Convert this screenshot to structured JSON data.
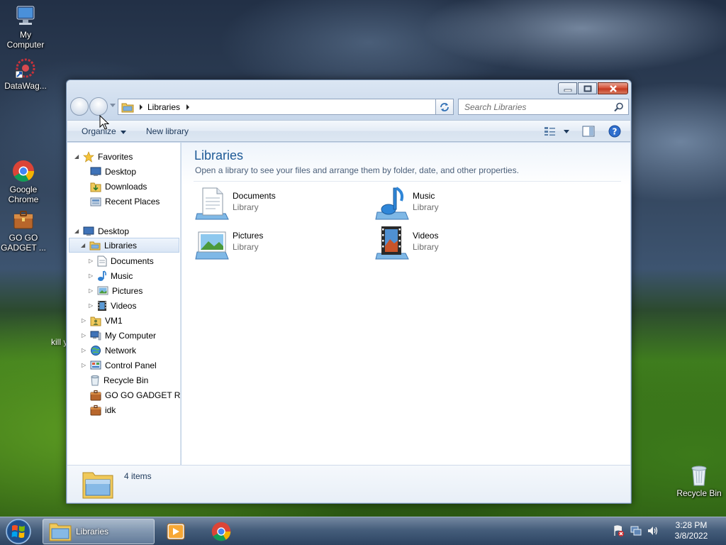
{
  "desktop": {
    "icons": [
      {
        "label": "My\nComputer"
      },
      {
        "label": "DataWag..."
      },
      {
        "label": "Google\nChrome"
      },
      {
        "label": "GO GO\nGADGET ..."
      },
      {
        "label": "Recycle Bin"
      }
    ],
    "stray_text": "kill y"
  },
  "window": {
    "address": {
      "crumb": "Libraries"
    },
    "search": {
      "placeholder": "Search Libraries"
    },
    "command_bar": {
      "organize": "Organize",
      "new_library": "New library"
    },
    "nav_tree": [
      {
        "label": "Favorites",
        "icon": "star-icon"
      },
      {
        "label": "Desktop",
        "icon": "desktop-icon"
      },
      {
        "label": "Downloads",
        "icon": "downloads-icon"
      },
      {
        "label": "Recent Places",
        "icon": "recent-places-icon"
      },
      {
        "label": "Desktop",
        "icon": "desktop-icon"
      },
      {
        "label": "Libraries",
        "icon": "libraries-icon",
        "selected": true
      },
      {
        "label": "Documents",
        "icon": "documents-icon"
      },
      {
        "label": "Music",
        "icon": "music-icon"
      },
      {
        "label": "Pictures",
        "icon": "pictures-icon"
      },
      {
        "label": "Videos",
        "icon": "videos-icon"
      },
      {
        "label": "VM1",
        "icon": "user-folder-icon"
      },
      {
        "label": "My Computer",
        "icon": "computer-icon"
      },
      {
        "label": "Network",
        "icon": "network-icon"
      },
      {
        "label": "Control Panel",
        "icon": "control-panel-icon"
      },
      {
        "label": "Recycle Bin",
        "icon": "recycle-bin-icon"
      },
      {
        "label": "GO GO GADGET RAR",
        "icon": "archive-icon"
      },
      {
        "label": "idk",
        "icon": "archive-icon"
      }
    ],
    "content": {
      "title": "Libraries",
      "subtitle": "Open a library to see your files and arrange them by folder, date, and other properties.",
      "libraries": [
        {
          "name": "Documents",
          "kind": "Library",
          "icon": "documents-library-icon"
        },
        {
          "name": "Music",
          "kind": "Library",
          "icon": "music-library-icon"
        },
        {
          "name": "Pictures",
          "kind": "Library",
          "icon": "pictures-library-icon"
        },
        {
          "name": "Videos",
          "kind": "Library",
          "icon": "videos-library-icon"
        }
      ]
    },
    "details": {
      "count_text": "4 items"
    }
  },
  "taskbar": {
    "active_window": "Libraries",
    "clock": {
      "time": "3:28 PM",
      "date": "3/8/2022"
    }
  },
  "colors": {
    "title_blue": "#1e5a96",
    "command_text": "#1e395b",
    "close_red": "#c43b22"
  }
}
